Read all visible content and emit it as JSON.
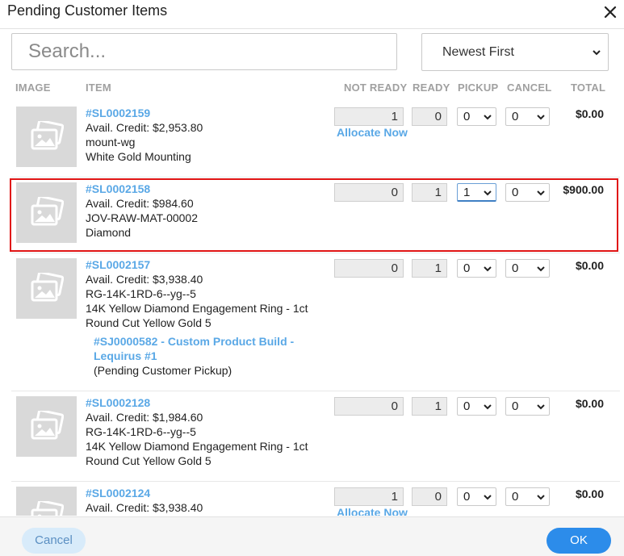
{
  "dialog": {
    "title": "Pending Customer Items"
  },
  "toolbar": {
    "search_placeholder": "Search...",
    "sort_selected": "Newest First"
  },
  "columns": {
    "image": "IMAGE",
    "item": "ITEM",
    "not_ready": "NOT READY",
    "ready": "READY",
    "pickup": "PICKUP",
    "cancel": "CANCEL",
    "total": "TOTAL"
  },
  "items": [
    {
      "sku": "#SL0002159",
      "credit": "Avail. Credit: $2,953.80",
      "code": "mount-wg",
      "desc": "White Gold Mounting",
      "not_ready": "1",
      "ready": "0",
      "pickup": "0",
      "cancel": "0",
      "total": "$0.00",
      "allocate": "Allocate Now"
    },
    {
      "sku": "#SL0002158",
      "credit": "Avail. Credit: $984.60",
      "code": "JOV-RAW-MAT-00002",
      "desc": "Diamond",
      "not_ready": "0",
      "ready": "1",
      "pickup": "1",
      "cancel": "0",
      "total": "$900.00"
    },
    {
      "sku": "#SL0002157",
      "credit": "Avail. Credit: $3,938.40",
      "code": "RG-14K-1RD-6--yg--5",
      "desc1": "14K Yellow Diamond Engagement Ring - 1ct",
      "desc2": "Round Cut Yellow Gold 5",
      "job_link": "#SJ0000582 - Custom Product Build - Lequirus #1",
      "job_status": "(Pending Customer Pickup)",
      "not_ready": "0",
      "ready": "1",
      "pickup": "0",
      "cancel": "0",
      "total": "$0.00"
    },
    {
      "sku": "#SL0002128",
      "credit": "Avail. Credit: $1,984.60",
      "code": "RG-14K-1RD-6--yg--5",
      "desc1": "14K Yellow Diamond Engagement Ring - 1ct",
      "desc2": "Round Cut Yellow Gold 5",
      "not_ready": "0",
      "ready": "1",
      "pickup": "0",
      "cancel": "0",
      "total": "$0.00"
    },
    {
      "sku": "#SL0002124",
      "credit": "Avail. Credit: $3,938.40",
      "not_ready": "1",
      "ready": "0",
      "pickup": "0",
      "cancel": "0",
      "total": "$0.00",
      "allocate": "Allocate Now"
    }
  ],
  "footer": {
    "cancel_label": "Cancel",
    "ok_label": "OK"
  },
  "colors": {
    "link": "#5aa8e6",
    "primary": "#2c8cea",
    "highlight": "#e01515"
  }
}
